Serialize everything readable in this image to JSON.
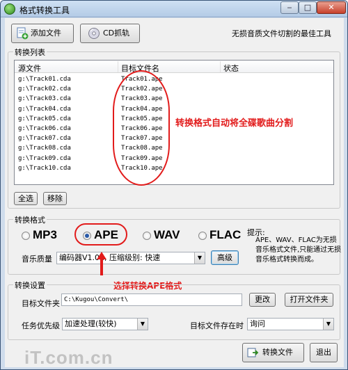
{
  "window": {
    "title": "格式转换工具",
    "min": "‒",
    "max": "□",
    "close": "✕"
  },
  "toolbar": {
    "add_file": "添加文件",
    "cd_rip": "CD抓轨",
    "tagline": "无损音质文件切割的最佳工具"
  },
  "list": {
    "group_label": "转换列表",
    "columns": [
      "源文件",
      "目标文件名",
      "状态"
    ],
    "rows": [
      {
        "src": "g:\\Track01.cda",
        "dst": "Track01.ape",
        "status": ""
      },
      {
        "src": "g:\\Track02.cda",
        "dst": "Track02.ape",
        "status": ""
      },
      {
        "src": "g:\\Track03.cda",
        "dst": "Track03.ape",
        "status": ""
      },
      {
        "src": "g:\\Track04.cda",
        "dst": "Track04.ape",
        "status": ""
      },
      {
        "src": "g:\\Track05.cda",
        "dst": "Track05.ape",
        "status": ""
      },
      {
        "src": "g:\\Track06.cda",
        "dst": "Track06.ape",
        "status": ""
      },
      {
        "src": "g:\\Track07.cda",
        "dst": "Track07.ape",
        "status": ""
      },
      {
        "src": "g:\\Track08.cda",
        "dst": "Track08.ape",
        "status": ""
      },
      {
        "src": "g:\\Track09.cda",
        "dst": "Track09.ape",
        "status": ""
      },
      {
        "src": "g:\\Track10.cda",
        "dst": "Track10.ape",
        "status": ""
      }
    ],
    "select_all": "全选",
    "remove": "移除"
  },
  "annotation_top": "转换格式自动将全碟歌曲分割",
  "format": {
    "group_label": "转换格式",
    "options": [
      "MP3",
      "APE",
      "WAV",
      "FLAC"
    ],
    "selected": "APE",
    "hint_title": "提示:",
    "hint_body": "APE、WAV、FLAC为无损音乐格式文件,只能通过无损音乐格式转换而成。",
    "quality_label": "音乐质量",
    "quality_value": "编码器V1.02, 压缩级别: 快速",
    "advanced": "高级"
  },
  "annotation_bottom": "选择转换APE格式",
  "settings": {
    "group_label": "转换设置",
    "target_folder_label": "目标文件夹",
    "target_folder_value": "C:\\Kugou\\Convert\\",
    "change": "更改",
    "open_folder": "打开文件夹",
    "priority_label": "任务优先级",
    "priority_value": "加速处理(较快)",
    "exists_label": "目标文件存在时",
    "exists_value": "询问"
  },
  "actions": {
    "convert": "转换文件",
    "exit": "退出"
  },
  "watermark": "iT.com.cn",
  "colors": {
    "annotation": "#e21b1b",
    "window_frame": "#cfdcec"
  }
}
